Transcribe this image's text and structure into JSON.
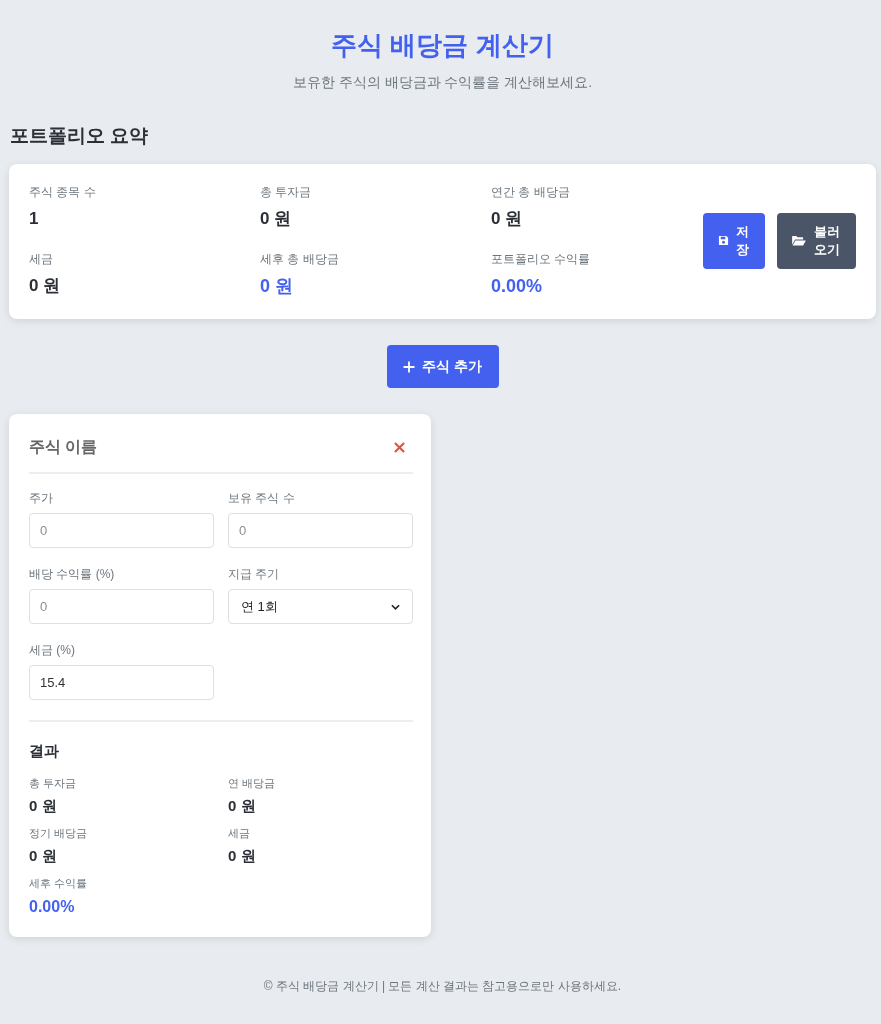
{
  "header": {
    "title": "주식 배당금 계산기",
    "subtitle": "보유한 주식의 배당금과 수익률을 계산해보세요."
  },
  "summary": {
    "title": "포트폴리오 요약",
    "stats": [
      {
        "label": "주식 종목 수",
        "value": "1",
        "accent": false
      },
      {
        "label": "총 투자금",
        "value": "0 원",
        "accent": false
      },
      {
        "label": "연간 총 배당금",
        "value": "0 원",
        "accent": false
      },
      {
        "label": "세금",
        "value": "0 원",
        "accent": false
      },
      {
        "label": "세후 총 배당금",
        "value": "0 원",
        "accent": true
      },
      {
        "label": "포트폴리오 수익률",
        "value": "0.00%",
        "accent": true
      }
    ],
    "buttons": [
      {
        "label": "저장",
        "kind": "save"
      },
      {
        "label": "불러오기",
        "kind": "load"
      }
    ]
  },
  "add_button": {
    "label": "주식 추가"
  },
  "stocks": [
    {
      "name": {
        "placeholder": "주식 이름"
      },
      "fields": [
        {
          "label": "주가",
          "kind": "input",
          "placeholder": "0"
        },
        {
          "label": "보유 주식 수",
          "kind": "input",
          "placeholder": "0"
        },
        {
          "label": "배당 수익률 (%)",
          "kind": "input",
          "placeholder": "0"
        },
        {
          "label": "지급 주기",
          "kind": "select",
          "value": "연 1회"
        },
        {
          "label": "세금 (%)",
          "kind": "input",
          "value": "15.4"
        }
      ],
      "results": {
        "title": "결과",
        "items": [
          {
            "label": "총 투자금",
            "value": "0 원",
            "accent": false
          },
          {
            "label": "연 배당금",
            "value": "0 원",
            "accent": false
          },
          {
            "label": "정기 배당금",
            "value": "0 원",
            "accent": false
          },
          {
            "label": "세금",
            "value": "0 원",
            "accent": false
          },
          {
            "label": "세후 수익률",
            "value": "0.00%",
            "accent": true
          }
        ]
      }
    }
  ],
  "footer": "© 주식 배당금 계산기 | 모든 계산 결과는 참고용으로만 사용하세요."
}
